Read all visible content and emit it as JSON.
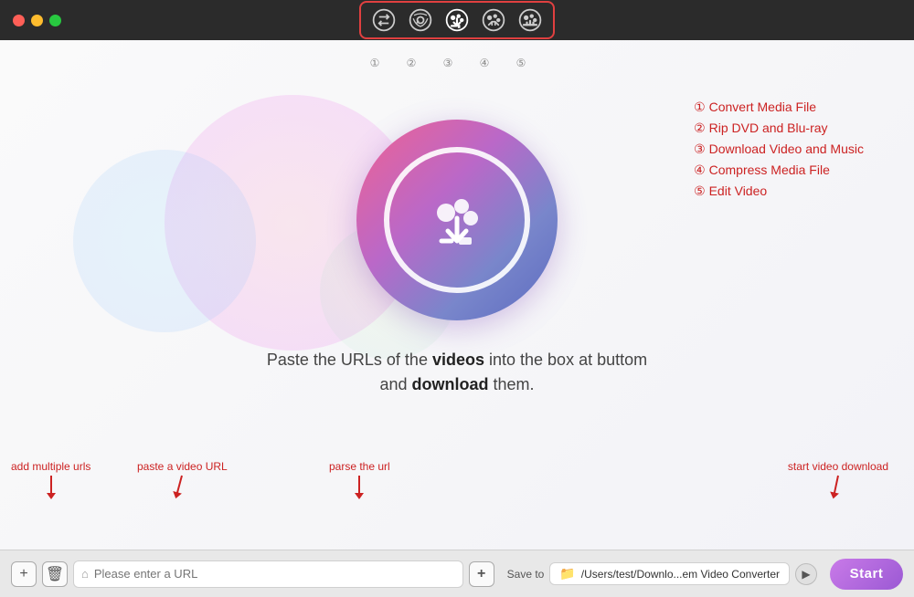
{
  "titlebar": {
    "traffic_lights": [
      "red",
      "yellow",
      "green"
    ]
  },
  "toolbar": {
    "icons": [
      {
        "id": "convert",
        "label": "①",
        "active": false
      },
      {
        "id": "rip-dvd",
        "label": "②",
        "active": false
      },
      {
        "id": "download",
        "label": "③",
        "active": true
      },
      {
        "id": "compress",
        "label": "④",
        "active": false
      },
      {
        "id": "edit",
        "label": "⑤",
        "active": false
      }
    ]
  },
  "feature_list": {
    "items": [
      {
        "num": "①",
        "label": "Convert Media File"
      },
      {
        "num": "②",
        "label": "Rip DVD and Blu-ray"
      },
      {
        "num": "③",
        "label": "Download Video and Music"
      },
      {
        "num": "④",
        "label": "Compress Media File"
      },
      {
        "num": "⑤",
        "label": "Edit Video"
      }
    ]
  },
  "instruction": {
    "text_part1": "Paste the URLs of the ",
    "bold1": "videos",
    "text_part2": " into the box at buttom",
    "text_part3": "and ",
    "bold2": "download",
    "text_part4": " them."
  },
  "annotations": {
    "add_urls": "add multiple urls",
    "paste_url": "paste a video URL",
    "parse_url": "parse the url",
    "start_download": "start video download"
  },
  "bottom_bar": {
    "url_placeholder": "Please enter a URL",
    "save_to_label": "Save to",
    "save_path": "/Users/test/Downlo...em Video Converter",
    "start_btn": "Start",
    "parse_btn": "+"
  }
}
